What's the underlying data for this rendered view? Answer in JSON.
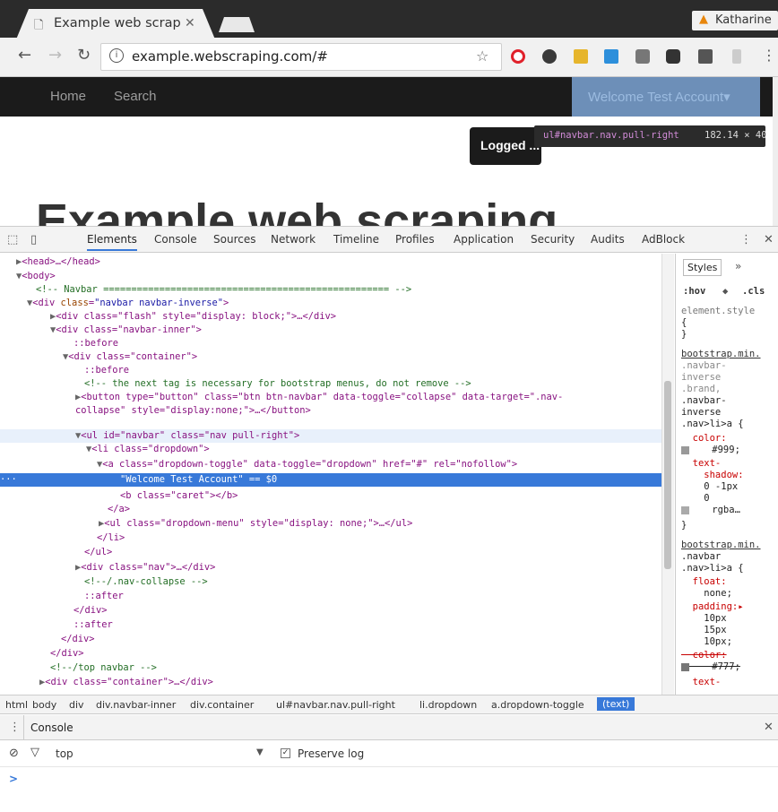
{
  "browser": {
    "tab_title": "Example web scrap",
    "tab_icon": "page-icon",
    "profile_name": "Katharine",
    "url": "example.webscraping.com/#"
  },
  "site": {
    "nav": [
      "Home",
      "Search"
    ],
    "welcome": "Welcome Test Account▾",
    "tooltip": "Logged ...",
    "inspect_selector": "ul#navbar.nav.pull-right",
    "inspect_dims": "182.14 × 40",
    "heading": "Example web scraping"
  },
  "devtools": {
    "tabs": [
      "Elements",
      "Console",
      "Sources",
      "Network",
      "Timeline",
      "Profiles",
      "Application",
      "Security",
      "Audits",
      "AdBlock"
    ],
    "styles_tabs": [
      "Styles",
      "»"
    ],
    "styles_filter": [
      ":hov",
      ".cls"
    ],
    "styles_lines": [
      "element.style",
      "{",
      "}",
      "bootstrap.min.",
      ".navbar-",
      "inverse",
      ".brand,",
      ".navbar-",
      "inverse",
      ".nav>li>a {",
      "  color:",
      "    #999;",
      "  text-",
      "    shadow:",
      "    0 -1px",
      "    0",
      "    rgba…",
      "}",
      "bootstrap.min.",
      ".navbar",
      ".nav>li>a {",
      "  float:",
      "    none;",
      "  padding:▸",
      "    10px",
      "    15px",
      "    10px;",
      "  color:",
      "    #777;",
      "  text-"
    ],
    "breadcrumbs": [
      "html",
      "body",
      "div",
      "div.navbar-inner",
      "div.container",
      "ul#navbar.nav.pull-right",
      "li.dropdown",
      "a.dropdown-toggle",
      "(text)"
    ],
    "console_label": "Console",
    "console_context": "top",
    "preserve_log": "Preserve log",
    "prompt": ">"
  },
  "dom": {
    "l0": "<head>…</head>",
    "l1": "<body>",
    "l2": "<!-- Navbar =================================================== -->",
    "l3_tag": "<div ",
    "l3_an": "class",
    "l3_av": "\"navbar navbar-inverse\"",
    "l4": "<div class=\"flash\" style=\"display: block;\">…</div>",
    "l5": "<div class=\"navbar-inner\">",
    "l6": "::before",
    "l7": "<div class=\"container\">",
    "l8": "::before",
    "l9": "<!-- the next tag is necessary for bootstrap menus, do not remove -->",
    "l10": "<button type=\"button\" class=\"btn btn-navbar\" data-toggle=\"collapse\" data-target=\".nav-",
    "l11": "collapse\" style=\"display:none;\">…</button>",
    "l12": "<ul id=\"navbar\" class=\"nav pull-right\">",
    "l13": "<li class=\"dropdown\">",
    "l14": "<a class=\"dropdown-toggle\" data-toggle=\"dropdown\" href=\"#\" rel=\"nofollow\">",
    "l15": "\"Welcome Test Account\" == $0",
    "l16": "<b class=\"caret\"></b>",
    "l17": "</a>",
    "l18": "<ul class=\"dropdown-menu\" style=\"display: none;\">…</ul>",
    "l19": "</li>",
    "l20": "</ul>",
    "l21": "<div class=\"nav\">…</div>",
    "l22": "<!--/.nav-collapse -->",
    "l23": "::after",
    "l24": "</div>",
    "l25": "::after",
    "l26": "</div>",
    "l27": "</div>",
    "l28": "<!--/top navbar -->",
    "l29": "<div class=\"container\">…</div>"
  }
}
